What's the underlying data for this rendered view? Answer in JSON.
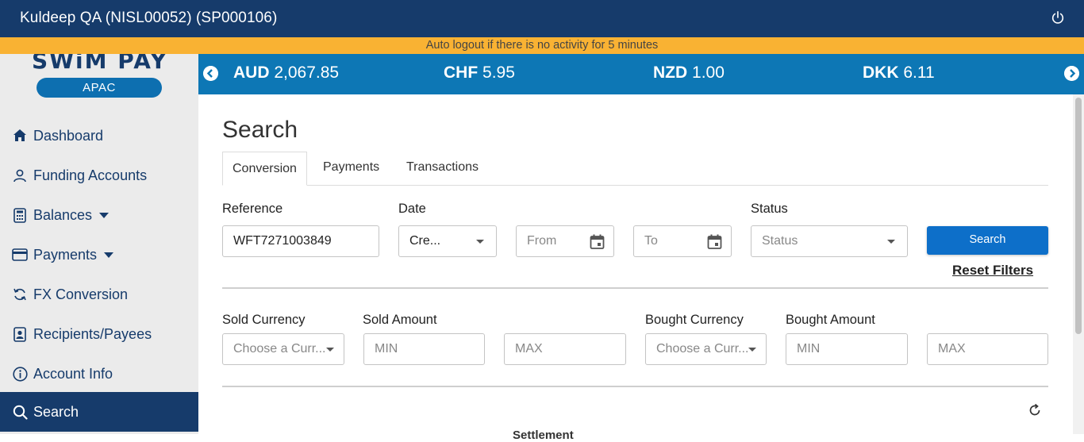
{
  "header": {
    "title": "Kuldeep QA (NISL00052) (SP000106)",
    "power_icon": "power-icon"
  },
  "notice": {
    "text": "Auto logout if there is no activity for 5 minutes"
  },
  "sidebar": {
    "brand": "SWiM PAY",
    "region": "APAC",
    "items": [
      {
        "label": "Dashboard",
        "icon": "home-icon",
        "caret": false,
        "active": false
      },
      {
        "label": "Funding Accounts",
        "icon": "user-icon",
        "caret": false,
        "active": false
      },
      {
        "label": "Balances",
        "icon": "calculator-icon",
        "caret": true,
        "active": false
      },
      {
        "label": "Payments",
        "icon": "credit-card-icon",
        "caret": true,
        "active": false
      },
      {
        "label": "FX Conversion",
        "icon": "sync-icon",
        "caret": false,
        "active": false
      },
      {
        "label": "Recipients/Payees",
        "icon": "contact-card-icon",
        "caret": false,
        "active": false
      },
      {
        "label": "Account Info",
        "icon": "info-icon",
        "caret": false,
        "active": false
      },
      {
        "label": "Search",
        "icon": "search-icon",
        "caret": false,
        "active": true
      }
    ]
  },
  "ticker": {
    "rates": [
      {
        "code": "AUD",
        "value": "2,067.85"
      },
      {
        "code": "CHF",
        "value": "5.95"
      },
      {
        "code": "NZD",
        "value": "1.00"
      },
      {
        "code": "DKK",
        "value": "6.11"
      }
    ]
  },
  "page": {
    "title": "Search",
    "tabs": [
      {
        "label": "Conversion",
        "active": true
      },
      {
        "label": "Payments",
        "active": false
      },
      {
        "label": "Transactions",
        "active": false
      }
    ]
  },
  "filters": {
    "reference_label": "Reference",
    "reference_value": "WFT7271003849",
    "date_label": "Date",
    "date_type_value": "Cre...",
    "from_placeholder": "From",
    "to_placeholder": "To",
    "status_label": "Status",
    "status_placeholder": "Status",
    "search_button": "Search",
    "reset_link": "Reset Filters",
    "sold_currency_label": "Sold Currency",
    "sold_currency_placeholder": "Choose a Curr...",
    "sold_amount_label": "Sold Amount",
    "sold_min_placeholder": "MIN",
    "sold_max_placeholder": "MAX",
    "bought_currency_label": "Bought Currency",
    "bought_currency_placeholder": "Choose a Curr...",
    "bought_amount_label": "Bought Amount",
    "bought_min_placeholder": "MIN",
    "bought_max_placeholder": "MAX"
  },
  "results": {
    "refresh_icon": "refresh-icon",
    "partial_column_header": "Settlement"
  },
  "colors": {
    "header_bg": "#163b6b",
    "notice_bg": "#f9b233",
    "ticker_bg": "#0d77b5",
    "accent": "#0d6fc9"
  }
}
